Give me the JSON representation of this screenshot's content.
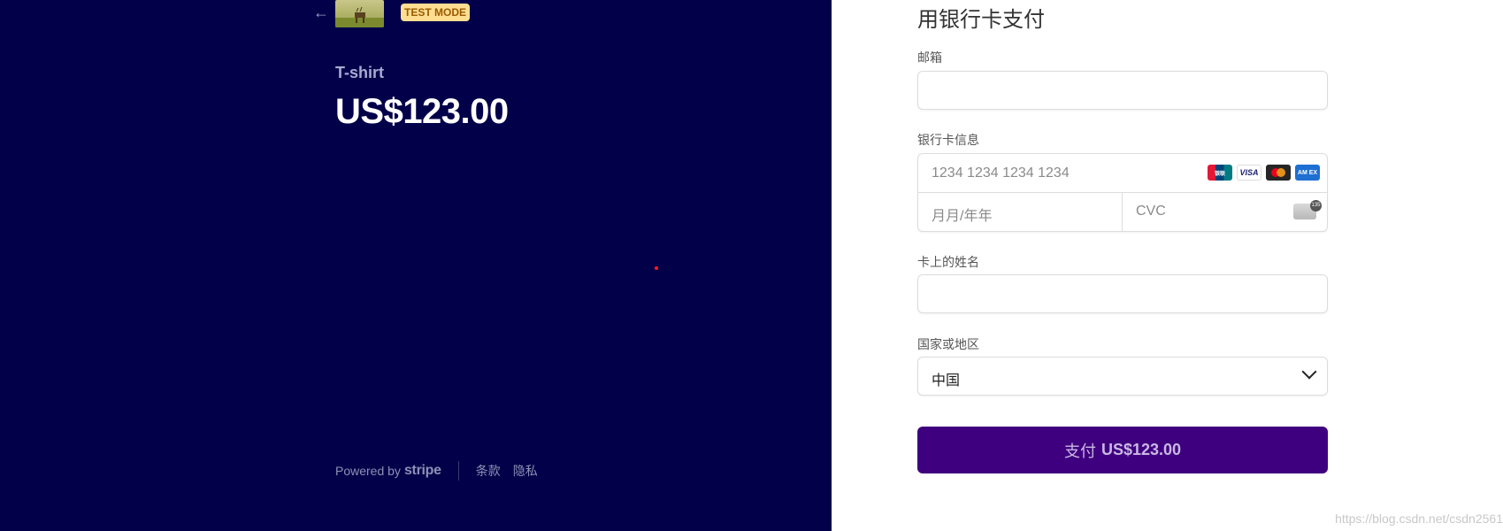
{
  "left": {
    "badge": "TEST MODE",
    "product_name": "T-shirt",
    "price": "US$123.00",
    "footer": {
      "powered_by": "Powered by",
      "brand": "stripe",
      "terms": "条款",
      "privacy": "隐私"
    }
  },
  "right": {
    "heading": "用银行卡支付",
    "email_label": "邮箱",
    "email_value": "",
    "card_label": "银行卡信息",
    "card_number_placeholder": "1234 1234 1234 1234",
    "expiry_placeholder": "月月/年年",
    "cvc_placeholder": "CVC",
    "card_brands": [
      "UnionPay",
      "VISA",
      "Mastercard",
      "AMEX"
    ],
    "name_label": "卡上的姓名",
    "name_value": "",
    "country_label": "国家或地区",
    "country_value": "中国",
    "pay_prefix": "支付",
    "pay_amount": "US$123.00"
  },
  "watermark": "https://blog.csdn.net/csdn2561",
  "colors": {
    "left_bg": "#03004a",
    "pay_button": "#3f007f",
    "badge_bg": "#ffde92"
  }
}
